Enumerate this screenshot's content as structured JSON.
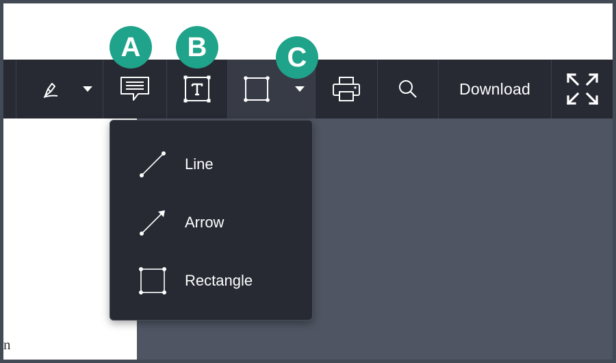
{
  "badges": {
    "a": "A",
    "b": "B",
    "c": "C"
  },
  "toolbar": {
    "download_label": "Download",
    "icons": [
      "pen-icon",
      "dropdown-caret-icon",
      "comment-icon",
      "text-box-icon",
      "rectangle-icon",
      "dropdown-caret-icon",
      "print-icon",
      "search-icon",
      "fullscreen-icon"
    ]
  },
  "document": {
    "visible_text": "n"
  },
  "shape_menu": {
    "items": [
      {
        "label": "Line",
        "icon": "line-icon"
      },
      {
        "label": "Arrow",
        "icon": "arrow-icon"
      },
      {
        "label": "Rectangle",
        "icon": "rectangle-icon"
      }
    ]
  },
  "colors": {
    "toolbar": "#272a33",
    "toolbar_active": "#373b46",
    "badge": "#1fa38a",
    "viewer_background": "#4f5562",
    "menu": "#272a33"
  }
}
